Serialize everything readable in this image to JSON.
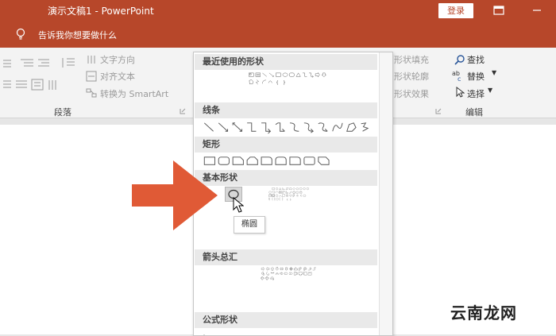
{
  "titlebar": {
    "title": "演示文稿1  -  PowerPoint",
    "login": "登录",
    "colors": {
      "accent": "#b7472a"
    }
  },
  "tellbar": {
    "text": "告诉我你想要做什么"
  },
  "ribbon": {
    "text_direction": "文字方向",
    "align_text": "对齐文本",
    "convert_smartart": "转换为 SmartArt",
    "paragraph_group": "段落",
    "shape_fill": "形状填充",
    "shape_outline": "形状轮廓",
    "shape_effects": "形状效果",
    "find": "查找",
    "replace": "替换",
    "select": "选择",
    "edit_group": "编辑"
  },
  "gallery": {
    "sections": [
      "最近使用的形状",
      "线条",
      "矩形",
      "基本形状",
      "箭头总汇",
      "公式形状"
    ]
  },
  "recent_braces": [
    "{",
    "}"
  ],
  "basic_braces": [
    "{",
    "}"
  ],
  "tooltip": "椭圆",
  "watermark": "云南龙网"
}
